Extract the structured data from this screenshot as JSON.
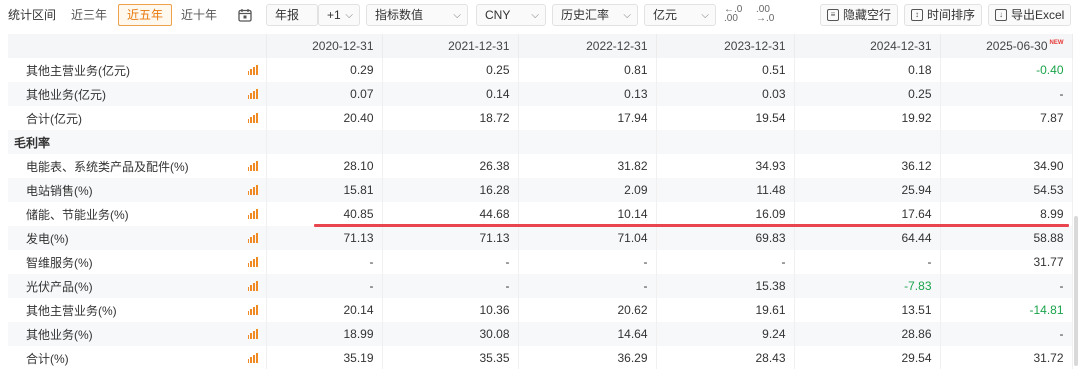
{
  "toolbar": {
    "label": "统计区间",
    "ranges": [
      "近三年",
      "近五年",
      "近十年"
    ],
    "active_range": "近五年",
    "report_type": "年报",
    "offset": "+1",
    "value_type": "指标数值",
    "currency": "CNY",
    "rate": "历史汇率",
    "unit": "亿元",
    "decimal_dec": "←.0\n.00",
    "decimal_inc": ".00\n→.0",
    "hide_empty": "隐藏空行",
    "time_sort": "时间排序",
    "export": "导出Excel"
  },
  "table": {
    "columns": [
      "",
      "2020-12-31",
      "2021-12-31",
      "2022-12-31",
      "2023-12-31",
      "2024-12-31",
      "2025-06-30"
    ],
    "new_badge": "NEW",
    "rows": [
      {
        "name": "其他主营业务(亿元)",
        "values": [
          "0.29",
          "0.25",
          "0.81",
          "0.51",
          "0.18",
          "-0.40"
        ],
        "neg": [
          false,
          false,
          false,
          false,
          false,
          true
        ],
        "chart": true
      },
      {
        "name": "其他业务(亿元)",
        "values": [
          "0.07",
          "0.14",
          "0.13",
          "0.03",
          "0.25",
          "-"
        ],
        "neg": [
          false,
          false,
          false,
          false,
          false,
          false
        ],
        "chart": true
      },
      {
        "name": "合计(亿元)",
        "values": [
          "20.40",
          "18.72",
          "17.94",
          "19.54",
          "19.92",
          "7.87"
        ],
        "neg": [
          false,
          false,
          false,
          false,
          false,
          false
        ],
        "chart": true
      },
      {
        "name": "毛利率",
        "values": [
          "",
          "",
          "",
          "",
          "",
          ""
        ],
        "neg": [
          false,
          false,
          false,
          false,
          false,
          false
        ],
        "chart": false,
        "section": true
      },
      {
        "name": "电能表、系统类产品及配件(%)",
        "values": [
          "28.10",
          "26.38",
          "31.82",
          "34.93",
          "36.12",
          "34.90"
        ],
        "neg": [
          false,
          false,
          false,
          false,
          false,
          false
        ],
        "chart": true
      },
      {
        "name": "电站销售(%)",
        "values": [
          "15.81",
          "16.28",
          "2.09",
          "11.48",
          "25.94",
          "54.53"
        ],
        "neg": [
          false,
          false,
          false,
          false,
          false,
          false
        ],
        "chart": true
      },
      {
        "name": "储能、节能业务(%)",
        "values": [
          "40.85",
          "44.68",
          "10.14",
          "16.09",
          "17.64",
          "8.99"
        ],
        "neg": [
          false,
          false,
          false,
          false,
          false,
          false
        ],
        "chart": true
      },
      {
        "name": "发电(%)",
        "values": [
          "71.13",
          "71.13",
          "71.04",
          "69.83",
          "64.44",
          "58.88"
        ],
        "neg": [
          false,
          false,
          false,
          false,
          false,
          false
        ],
        "chart": true
      },
      {
        "name": "智维服务(%)",
        "values": [
          "-",
          "-",
          "-",
          "-",
          "-",
          "31.77"
        ],
        "neg": [
          false,
          false,
          false,
          false,
          false,
          false
        ],
        "chart": true
      },
      {
        "name": "光伏产品(%)",
        "values": [
          "-",
          "-",
          "-",
          "15.38",
          "-7.83",
          "-"
        ],
        "neg": [
          false,
          false,
          false,
          false,
          true,
          false
        ],
        "chart": true
      },
      {
        "name": "其他主营业务(%)",
        "values": [
          "20.14",
          "10.36",
          "20.62",
          "19.61",
          "13.51",
          "-14.81"
        ],
        "neg": [
          false,
          false,
          false,
          false,
          false,
          true
        ],
        "chart": true
      },
      {
        "name": "其他业务(%)",
        "values": [
          "18.99",
          "30.08",
          "14.64",
          "9.24",
          "28.86",
          "-"
        ],
        "neg": [
          false,
          false,
          false,
          false,
          false,
          false
        ],
        "chart": true
      },
      {
        "name": "合计(%)",
        "values": [
          "35.19",
          "35.35",
          "36.29",
          "28.43",
          "29.54",
          "31.72"
        ],
        "neg": [
          false,
          false,
          false,
          false,
          false,
          false
        ],
        "chart": true
      }
    ]
  },
  "colors": {
    "accent": "#e8790d",
    "negative": "#1aa34a",
    "highlight_line": "#e8454f",
    "chart_icon": "#f08a24"
  }
}
